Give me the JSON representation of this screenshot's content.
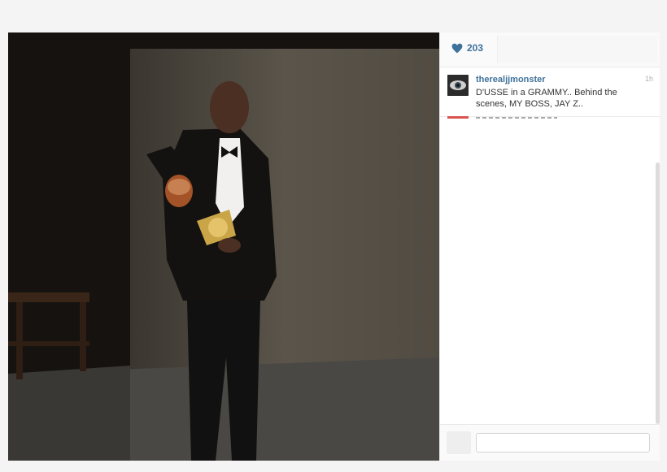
{
  "likes": {
    "count": "203"
  },
  "caption": {
    "username": "therealjjmonster",
    "time": "1h",
    "text": "D'USSE in a GRAMMY.. Behind the scenes, MY BOSS, JAY Z.."
  },
  "comment_box": {
    "placeholder": ""
  },
  "colors": {
    "link": "#3f729b",
    "heart": "#3f729b"
  }
}
